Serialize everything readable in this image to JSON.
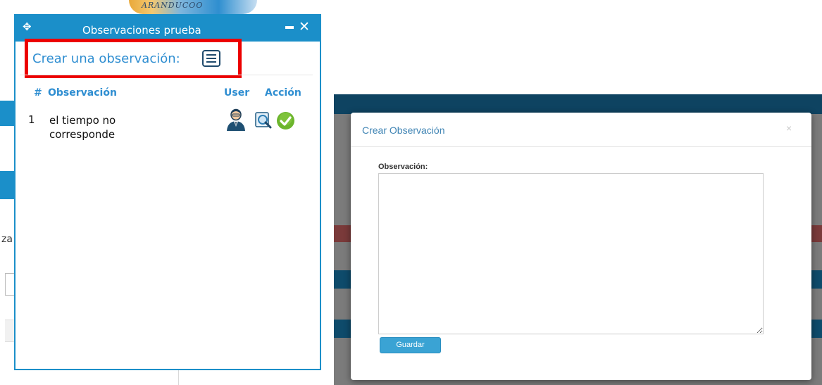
{
  "background_app": {
    "fragment_text": "za",
    "logo_text": "ARANDUCOO"
  },
  "observations_panel": {
    "title": "Observaciones prueba",
    "move_icon": "move-icon",
    "minimize_icon": "minimize-icon",
    "close_icon": "close-icon",
    "create_label": "Crear una observación:",
    "create_icon": "document-list-icon",
    "highlight_color": "#ec0000",
    "accent_color": "#1b8fc9",
    "columns": {
      "number": "#",
      "observation": "Observación",
      "user": "User",
      "action": "Acción"
    },
    "rows": [
      {
        "number": "1",
        "text": "el tiempo no corresponde",
        "user_icon": "user-avatar-icon",
        "action_icons": [
          "search-icon",
          "check-icon"
        ]
      }
    ]
  },
  "modal": {
    "title": "Crear Observación",
    "close_symbol": "×",
    "field_label": "Observación:",
    "textarea_value": "",
    "save_button": "Guardar",
    "button_color": "#3aa3d4"
  }
}
